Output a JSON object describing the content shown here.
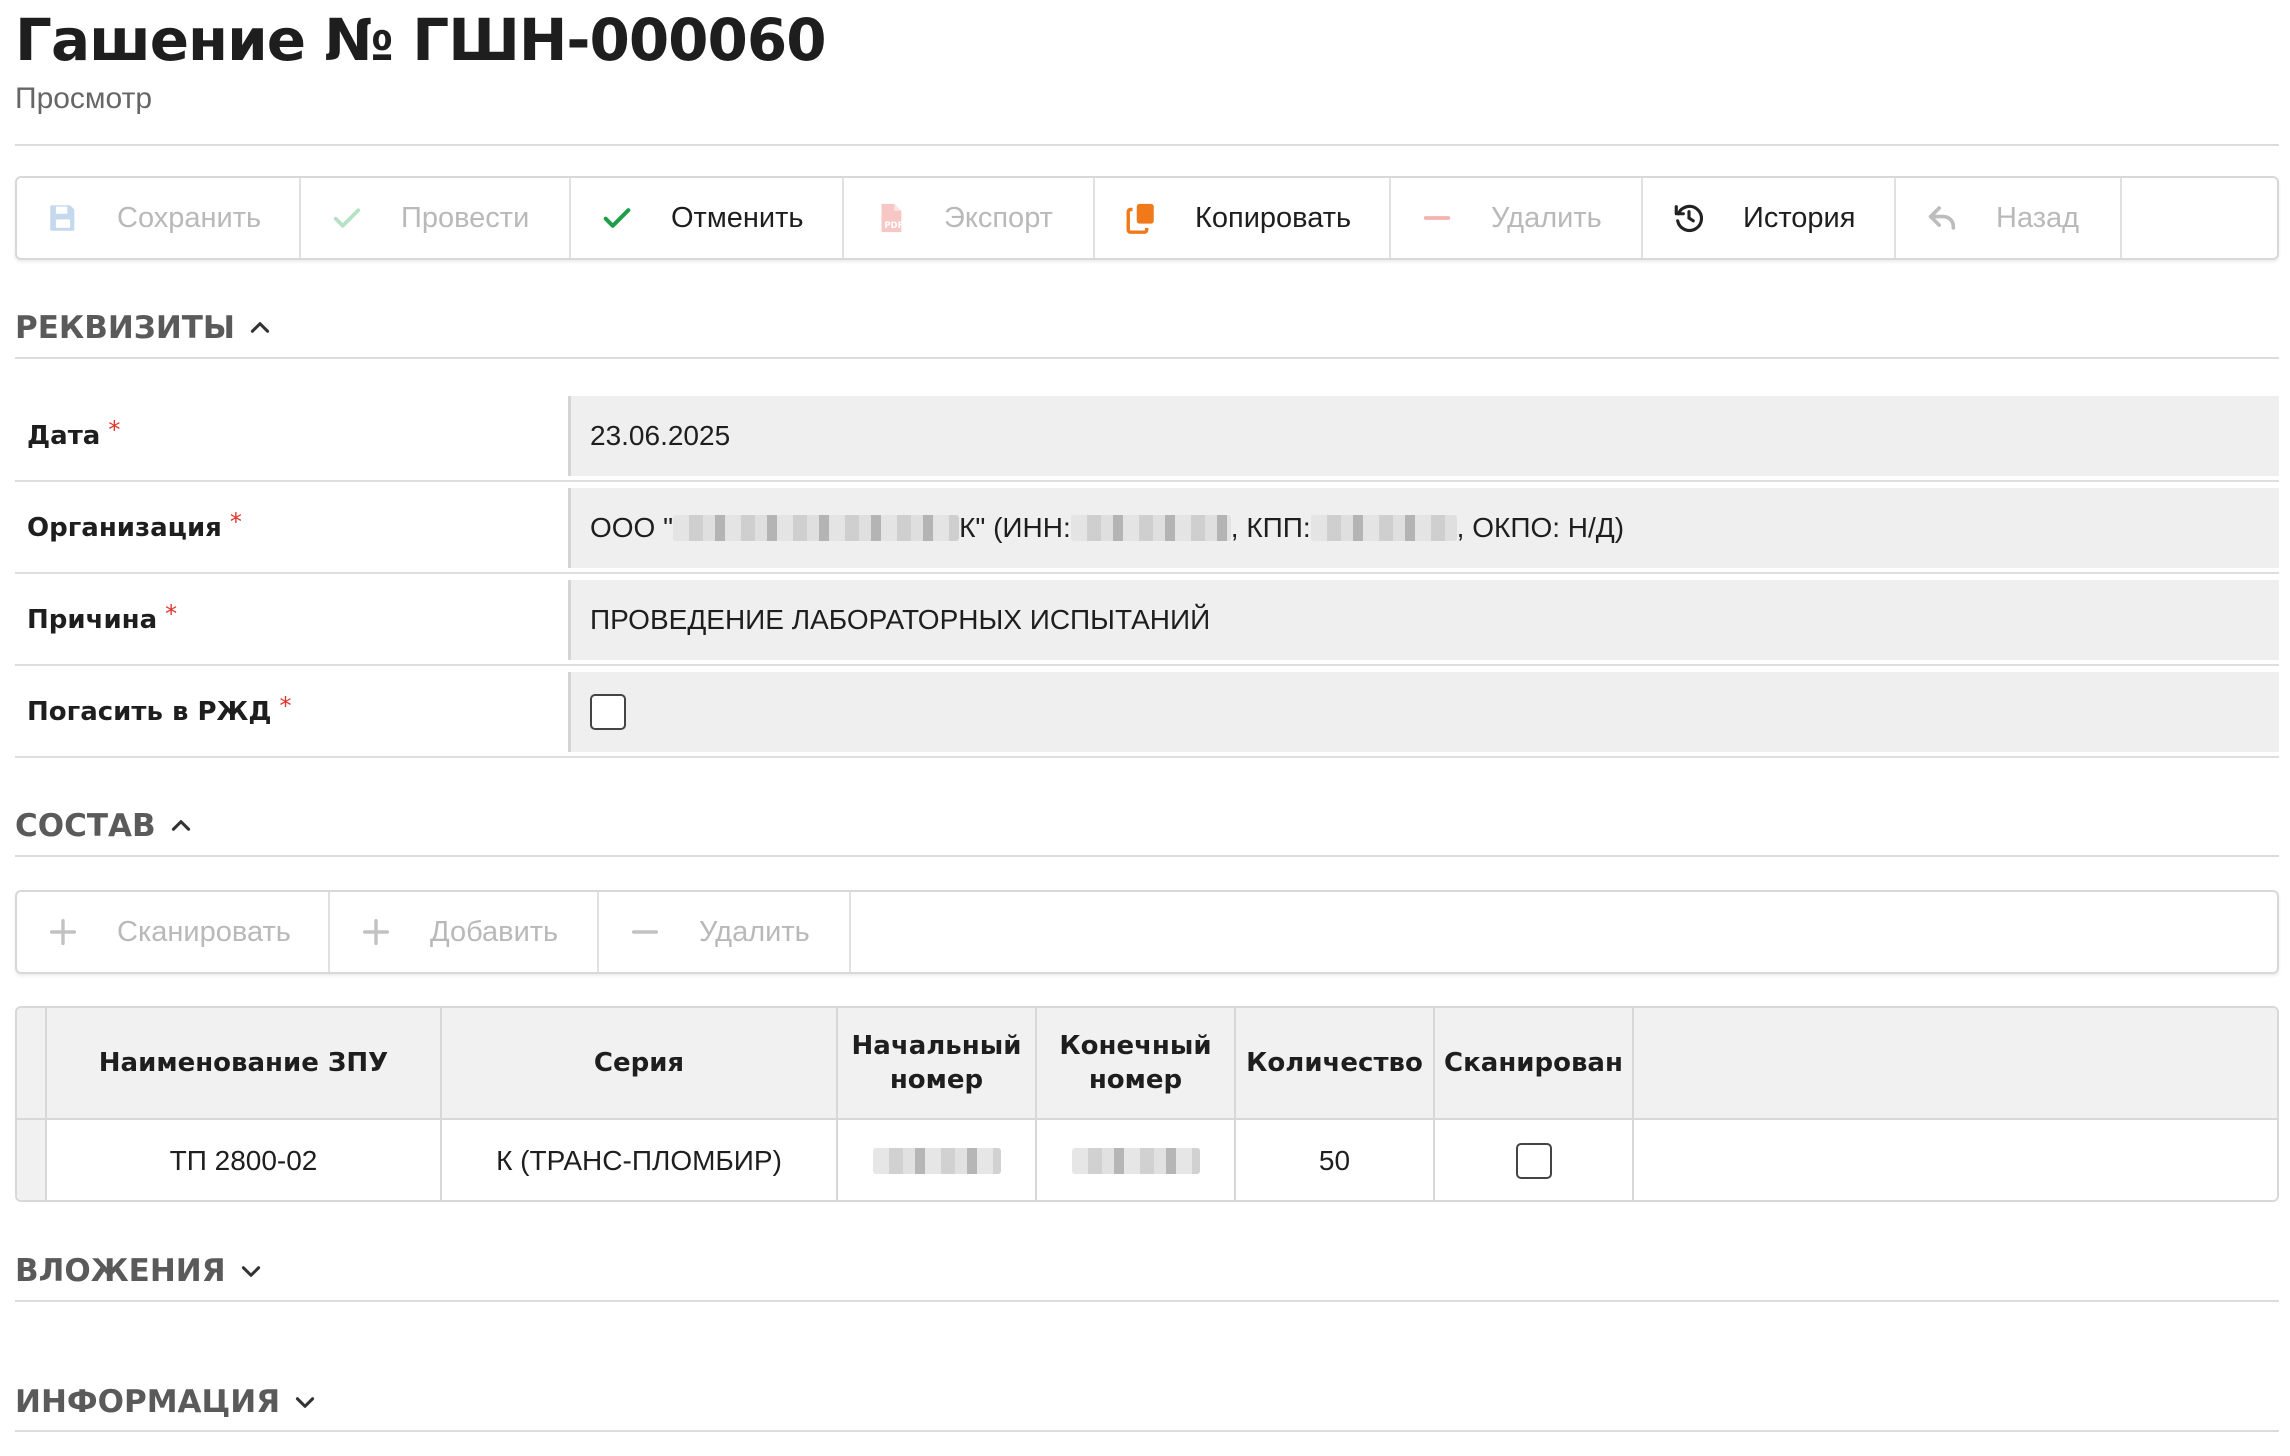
{
  "header": {
    "title": "Гашение № ГШН-000060",
    "subtitle": "Просмотр"
  },
  "toolbar": {
    "buttons": [
      {
        "label": "Сохранить",
        "icon": "save-icon",
        "enabled": false
      },
      {
        "label": "Провести",
        "icon": "check-icon",
        "enabled": false
      },
      {
        "label": "Отменить",
        "icon": "check-icon",
        "enabled": true
      },
      {
        "label": "Экспорт",
        "icon": "pdf-icon",
        "enabled": false
      },
      {
        "label": "Копировать",
        "icon": "copy-icon",
        "enabled": true
      },
      {
        "label": "Удалить",
        "icon": "minus-icon",
        "enabled": false
      },
      {
        "label": "История",
        "icon": "history-icon",
        "enabled": true
      },
      {
        "label": "Назад",
        "icon": "back-arrow-icon",
        "enabled": false
      }
    ]
  },
  "sections": {
    "requisites": "РЕКВИЗИТЫ",
    "composition": "СОСТАВ",
    "attachments": "ВЛОЖЕНИЯ",
    "information": "ИНФОРМАЦИЯ"
  },
  "fields": {
    "date": {
      "label": "Дата",
      "required": "*",
      "value": "23.06.2025"
    },
    "organization": {
      "label": "Организация",
      "required": "*",
      "prefix": "ООО \"",
      "name_tail": "К\" (ИНН:",
      "kpp_label": ", КПП:",
      "okpo": ", ОКПО: Н/Д)"
    },
    "reason": {
      "label": "Причина",
      "required": "*",
      "value": "ПРОВЕДЕНИЕ ЛАБОРАТОРНЫХ ИСПЫТАНИЙ"
    },
    "cancel_rzd": {
      "label": "Погасить в РЖД",
      "required": "*",
      "checked": false
    }
  },
  "composition_toolbar": {
    "buttons": [
      {
        "label": "Сканировать",
        "icon": "plus-icon",
        "enabled": false
      },
      {
        "label": "Добавить",
        "icon": "plus-icon",
        "enabled": false
      },
      {
        "label": "Удалить",
        "icon": "minus-icon",
        "enabled": false
      }
    ]
  },
  "table": {
    "columns": [
      "Наименование ЗПУ",
      "Серия",
      "Начальный номер",
      "Конечный номер",
      "Количество",
      "Сканирован"
    ],
    "rows": [
      {
        "name": "ТП 2800-02",
        "series": "К (ТРАНС-ПЛОМБИР)",
        "start": "",
        "end": "",
        "quantity": "50",
        "scanned": false
      }
    ]
  },
  "colors": {
    "accent_orange": "#f07a1a",
    "check_green": "#1f9e4a",
    "required_red": "#e0342b",
    "disabled_text": "#b9b9b9"
  }
}
